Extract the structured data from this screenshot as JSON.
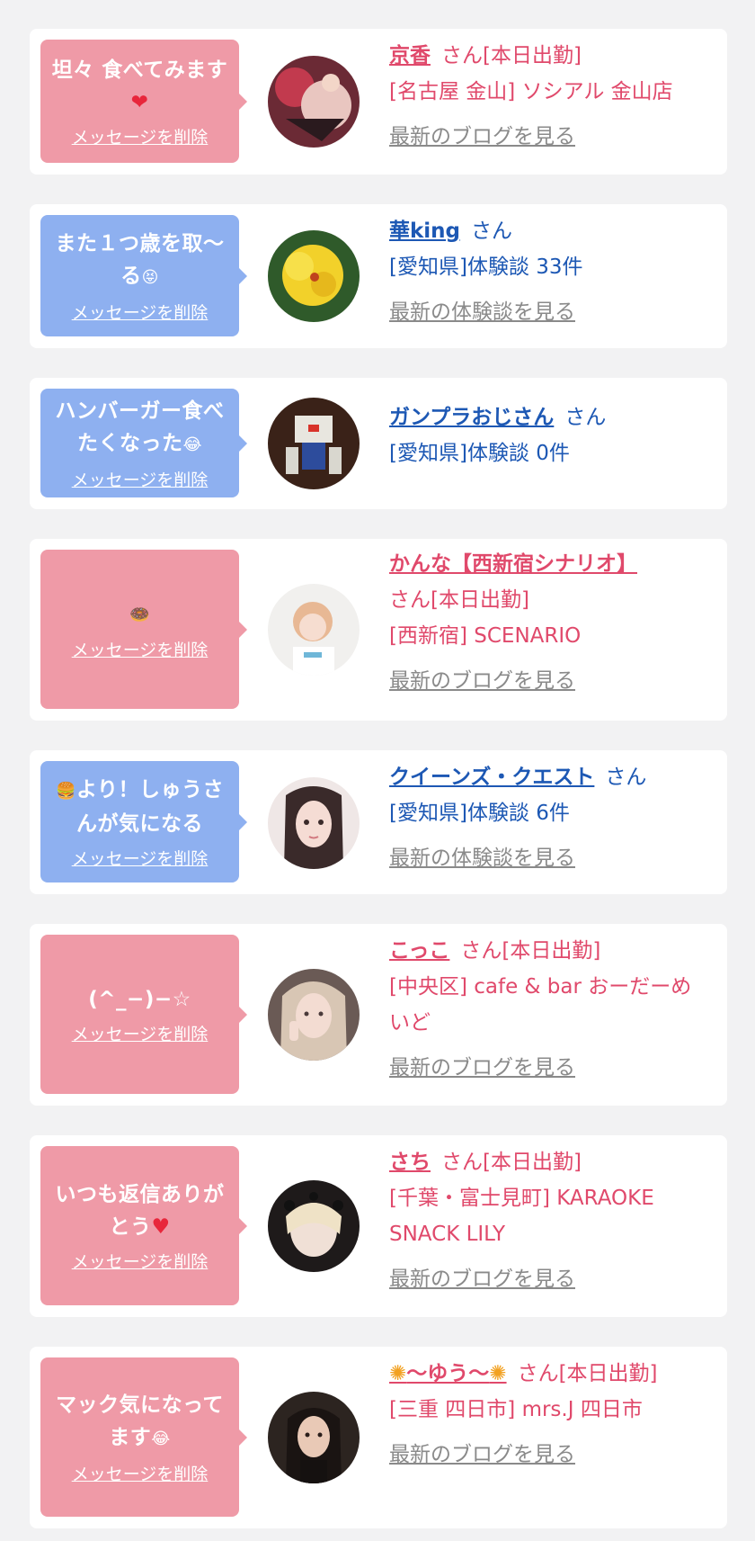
{
  "delete_label": "メッセージを削除",
  "items": [
    {
      "message": "坦々 食べてみます",
      "message_emoji": "❤",
      "name": "京香",
      "suffix": "さん[本日出勤]",
      "location": "[名古屋 金山] ソシアル 金山店",
      "link": "最新のブログを見る"
    },
    {
      "message": "また１つ歳を取〜る",
      "message_emoji": "😝",
      "name": "華king",
      "suffix": "さん",
      "location": "[愛知県]体験談 33件",
      "link": "最新の体験談を見る"
    },
    {
      "message": "ハンバーガー食べたくなった",
      "message_emoji": "😂",
      "name": "ガンプラおじさん",
      "suffix": "さん",
      "location": "[愛知県]体験談 0件"
    },
    {
      "message": "",
      "message_emoji": "🍩",
      "name": "かんな【西新宿シナリオ】",
      "suffix": "さん[本日出勤]",
      "location": "[西新宿] SCENARIO",
      "link": "最新のブログを見る"
    },
    {
      "message": "より！しゅうさんが気になる",
      "message_emoji": "🍔",
      "name": "クイーンズ・クエスト",
      "suffix": "さん",
      "location": "[愛知県]体験談 6件",
      "link": "最新の体験談を見る"
    },
    {
      "message": "(^_−)−☆",
      "name": "こっこ",
      "suffix": "さん[本日出勤]",
      "location": "[中央区] cafe & bar おーだーめいど",
      "link": "最新のブログを見る"
    },
    {
      "message": "いつも返信ありがとう",
      "message_emoji": "♥",
      "name": "さち",
      "suffix": "さん[本日出勤]",
      "location": "[千葉・富士見町] KARAOKE SNACK LILY",
      "link": "最新のブログを見る"
    },
    {
      "message": "マック気になってます",
      "message_emoji": "😂",
      "name": "〜ゆう〜",
      "name_decoration": "✺",
      "suffix": "さん[本日出勤]",
      "location": "[三重 四日市] mrs.J 四日市",
      "link": "最新のブログを見る"
    }
  ],
  "colors": {
    "pink": "#ef9aa7",
    "blue": "#8eb0f0",
    "name_pink": "#e0496b",
    "name_blue": "#1d58b4",
    "link_gray": "#8a8a8a",
    "background": "#f2f2f3"
  }
}
